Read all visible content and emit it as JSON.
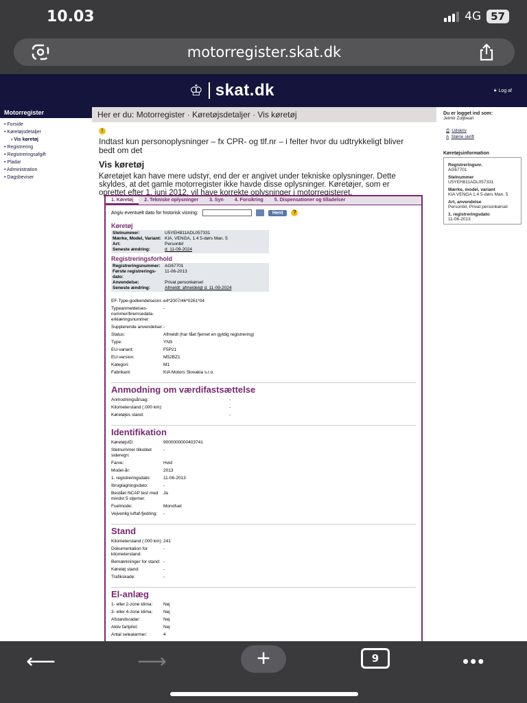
{
  "status": {
    "time": "10.03",
    "network": "4G",
    "battery": "57"
  },
  "browser": {
    "url": "motorregister.skat.dk",
    "tab_count": "9"
  },
  "header": {
    "logo_text": "skat.dk",
    "logout_label": "Log af"
  },
  "leftnav": {
    "heading": "Motorregister",
    "items": [
      {
        "label": "• Forside",
        "level": 0
      },
      {
        "label": "• Køretøjsdetaljer",
        "level": 0
      },
      {
        "label": "› Vis køretøj",
        "level": 2
      },
      {
        "label": "• Registrering",
        "level": 0
      },
      {
        "label": "• Registreringsafgift",
        "level": 0
      },
      {
        "label": "• Pladar",
        "level": 0
      },
      {
        "label": "• Administration",
        "level": 0
      },
      {
        "label": "• Dagsbeviser",
        "level": 0
      }
    ]
  },
  "breadcrumb": "Her er du: Motorregister · Køretøjsdetaljer · Vis køretøj",
  "notice": "Indtast kun personoplysninger – fx CPR- og tlf.nr – i felter hvor du udtrykkeligt bliver bedt om det",
  "page_title": "Vis køretøj",
  "intro": "Køretøjet kan have mere udstyr, end der er angivet under tekniske oplysninger. Dette skyldes, at det gamle motorregister ikke havde disse oplysninger. Køretøjer, som er oprettet efter 1. juni 2012, vil have korrekte oplysninger i motorregisteret.",
  "tabs": [
    "1. Køretøj",
    "2. Tekniske oplysninger",
    "3. Syn",
    "4. Forsikring",
    "5. Dispensationer og tilladelser"
  ],
  "history": {
    "label": "Angiv eventuelt dato for historisk visning:",
    "button": "Hent"
  },
  "koretoj": {
    "title": "Køretøj",
    "rows": [
      {
        "k": "Stelnummer:",
        "v": "U5YEH811ADL057331"
      },
      {
        "k": "Mærke, Model, Variant:",
        "v": "KIA, VENGA, 1.4 5-dørs Man. 5"
      },
      {
        "k": "Art:",
        "v": "Personbil"
      },
      {
        "k": "Seneste ændring:",
        "v": "d. 11-09-2024"
      }
    ]
  },
  "reg": {
    "title": "Registreringsforhold",
    "rows": [
      {
        "k": "Registreringsnummer:",
        "v": "AG67701"
      },
      {
        "k": "Første registrerings-dato:",
        "v": "11-06-2013"
      },
      {
        "k": "Anvendelse:",
        "v": "Privat personkørsel"
      },
      {
        "k": "Seneste ændring:",
        "v": "Afmeldt: afmeldelgt d. 11-09-2024"
      }
    ]
  },
  "details": [
    {
      "k": "EF-Type-godkendelsesnr.:",
      "v": "e4*2007/46*0261*04"
    },
    {
      "k": "Typeanmeldelses-nummer/bremsedata-erklæringsnummer:",
      "v": "-"
    },
    {
      "k": "Supplerende anvendelser:",
      "v": "-"
    },
    {
      "k": "Status:",
      "v": "Afmeldt (har fået fjernet en gyldig registrering)"
    },
    {
      "k": "Type:",
      "v": "YNS"
    },
    {
      "k": "EU-variant:",
      "v": "F5P21"
    },
    {
      "k": "EU-version:",
      "v": "M52BZ1"
    },
    {
      "k": "Kategori:",
      "v": "M1"
    },
    {
      "k": "Fabrikant:",
      "v": "KIA Motors Slovakia s.r.o."
    }
  ],
  "anmodning": {
    "title": "Anmodning om værdifastsættelse",
    "rows": [
      {
        "k": "Anmodningsårsag:",
        "v": "-"
      },
      {
        "k": "Kilometerstand (.000 km):",
        "v": "-"
      },
      {
        "k": "Køretøjes stand:",
        "v": "-"
      }
    ]
  },
  "identifikation": {
    "title": "Identifikation",
    "rows": [
      {
        "k": "KøretøjsID:",
        "v": "9000000000403741"
      },
      {
        "k": "Stelnummer tilkoblet sideregn:",
        "v": "-"
      },
      {
        "k": "Farve:",
        "v": "Hvid"
      },
      {
        "k": "Model-år:",
        "v": "2013"
      },
      {
        "k": "1. registreringsdato:",
        "v": "11-06-2013"
      },
      {
        "k": "Ibrugtagningsdato:",
        "v": "-"
      },
      {
        "k": "Bestået NCAP test med mindst 5 stjerner:",
        "v": "Ja"
      },
      {
        "k": "Fuelmode:",
        "v": "Monofuel"
      },
      {
        "k": "Vejvenlig luftaf-fjedring:",
        "v": "-"
      }
    ]
  },
  "stand": {
    "title": "Stand",
    "rows": [
      {
        "k": "Kilometerstand (.000 km):",
        "v": "241"
      },
      {
        "k": "Dokumentation for kilometerstand:",
        "v": "-"
      },
      {
        "k": "Bemærkninger for stand:",
        "v": "-"
      },
      {
        "k": "Køretøj stand:",
        "v": "-"
      },
      {
        "k": "Trafikskade:",
        "v": "-"
      }
    ]
  },
  "elanlaeg": {
    "title": "El-anlæg",
    "rows": [
      {
        "k": "1- eller 2-zone klima:",
        "v": "Nej"
      },
      {
        "k": "3- eller 4-zone klima:",
        "v": "Nej"
      },
      {
        "k": "Afstandsradar:",
        "v": "Nej"
      },
      {
        "k": "Aktiv fartpilot:",
        "v": "Nej"
      },
      {
        "k": "Antal selealarmer:",
        "v": "4"
      }
    ]
  },
  "rightcol": {
    "logged_in_heading": "Du er logget ind som:",
    "user": "Jetmir Zuljbeari",
    "print_link": "Udskriv",
    "bigger_text_link": "Større skrift",
    "info_heading": "Køretøjsinformation",
    "info": [
      {
        "k": "Registreringsnr.",
        "v": "AG67701"
      },
      {
        "k": "Stelnummer",
        "v": "U5YEH811ADL057331"
      },
      {
        "k": "Mærke, model, variant",
        "v": "KIA VENGA 1.4 5-dørs Man. 5"
      },
      {
        "k": "Art, anvendelse",
        "v": "Personbil, Privat personkørsel"
      },
      {
        "k": "1. registreringsdato",
        "v": "11-06-2013"
      }
    ]
  }
}
